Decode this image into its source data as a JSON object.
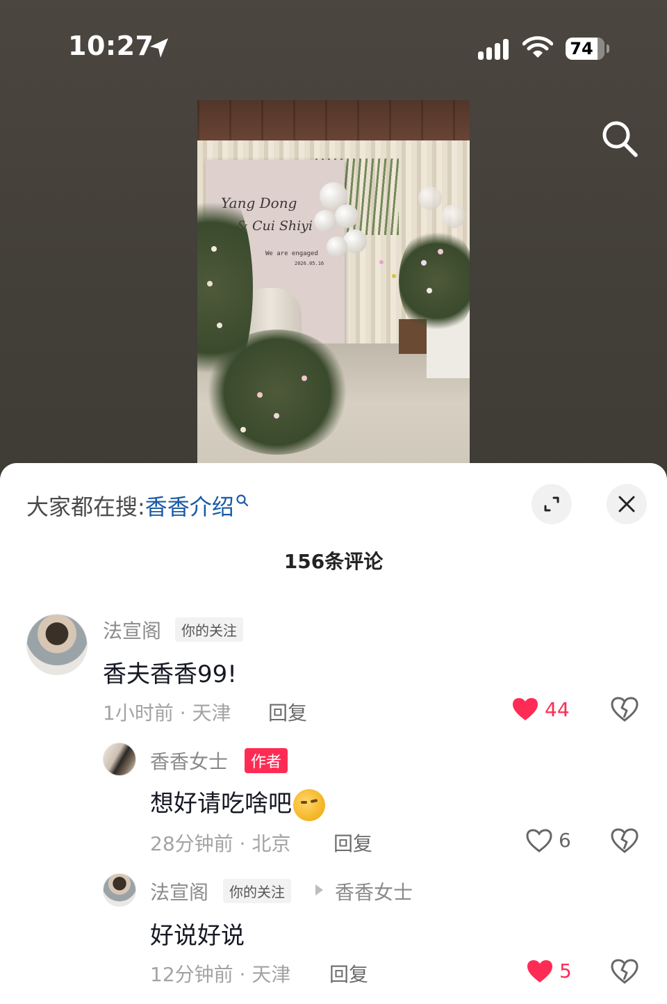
{
  "status_bar": {
    "time": "10:27",
    "battery": "74",
    "icons": [
      "location-arrow-icon",
      "signal-icon",
      "wifi-icon",
      "battery-icon"
    ]
  },
  "video": {
    "card_name_line1": "Yang Dong",
    "card_name_line2": "& Cui Shiyi",
    "card_tagline": "We are engaged",
    "card_date": "2026.05.16"
  },
  "comments_sheet": {
    "hot_search_label": "大家都在搜:",
    "hot_search_term": "香香介绍",
    "count_label": "156条评论",
    "accent_color": "#fe2c55",
    "link_color": "#1a5aa6",
    "comments": [
      {
        "username": "法宣阁",
        "tag": "你的关注",
        "text": "香夫香香99!",
        "time_location": "1小时前 · 天津",
        "reply_label": "回复",
        "likes": "44",
        "liked": true
      },
      {
        "username": "香香女士",
        "tag": "作者",
        "text": "想好请吃啥吧",
        "emoji": "thinking-face-emoji",
        "time_location": "28分钟前 · 北京",
        "reply_label": "回复",
        "likes": "6",
        "liked": false
      },
      {
        "username": "法宣阁",
        "tag": "你的关注",
        "reply_to": "香香女士",
        "text": "好说好说",
        "time_location": "12分钟前 · 天津",
        "reply_label": "回复",
        "likes": "5",
        "liked": true
      }
    ]
  }
}
